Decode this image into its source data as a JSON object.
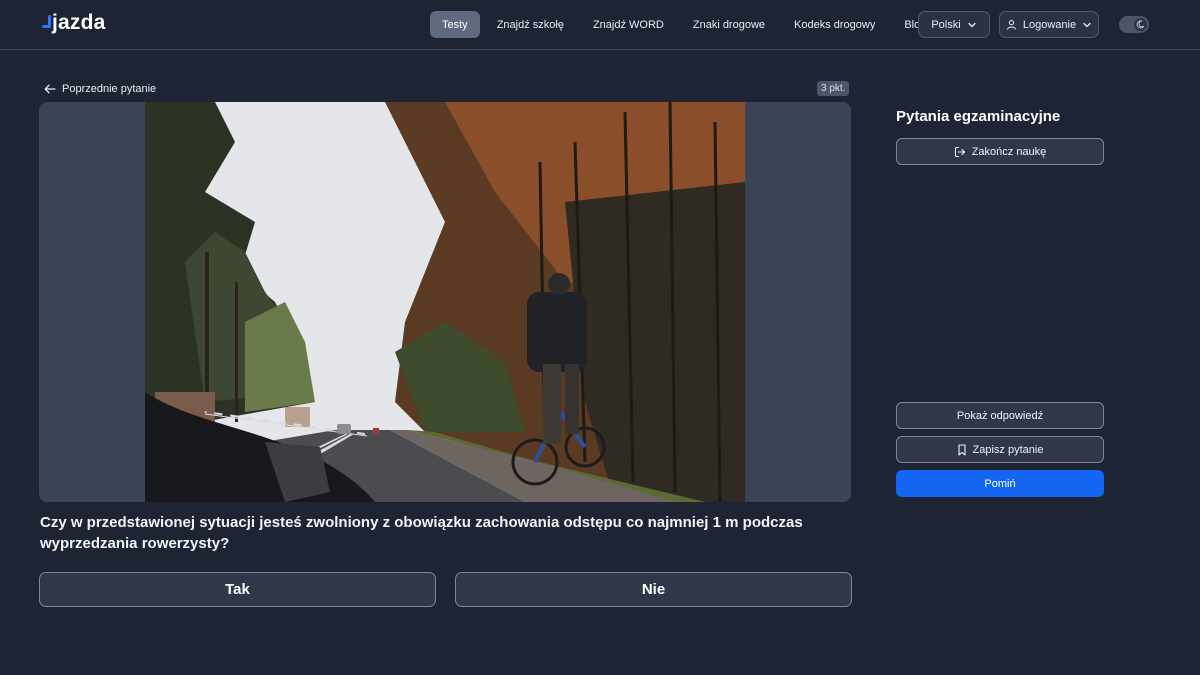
{
  "header": {
    "logo": "jazda",
    "nav": [
      "Testy",
      "Znajdź szkołę",
      "Znajdź WORD",
      "Znaki drogowe",
      "Kodeks drogowy",
      "Blog"
    ],
    "active_nav": "Testy",
    "language": "Polski",
    "login": "Logowanie"
  },
  "question": {
    "back_label": "Poprzednie pytanie",
    "points": "3 pkt.",
    "text": "Czy w przedstawionej sytuacji jesteś zwolniony z obowiązku zachowania odstępu co najmniej 1 m podczas wyprzedzania rowerzysty?",
    "answers": {
      "yes": "Tak",
      "no": "Nie"
    }
  },
  "sidebar": {
    "title": "Pytania egzaminacyjne",
    "finish_label": "Zakończ naukę",
    "show_answer_label": "Pokaż odpowiedź",
    "save_label": "Zapisz pytanie",
    "skip_label": "Pomiń"
  },
  "colors": {
    "background": "#1e2433",
    "primary": "#1466f2",
    "logo_accent": "#2f73ff"
  }
}
